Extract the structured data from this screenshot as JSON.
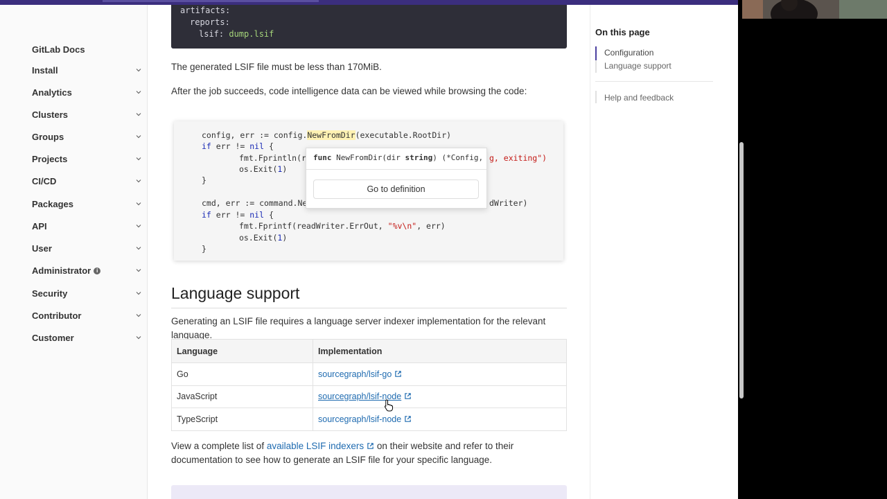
{
  "sidebar": {
    "brand": "GitLab Docs",
    "items": [
      {
        "label": "Install"
      },
      {
        "label": "Analytics"
      },
      {
        "label": "Clusters"
      },
      {
        "label": "Groups"
      },
      {
        "label": "Projects"
      },
      {
        "label": "CI/CD"
      },
      {
        "label": "Packages"
      },
      {
        "label": "API"
      },
      {
        "label": "User"
      },
      {
        "label": "Administrator"
      },
      {
        "label": "Security"
      },
      {
        "label": "Contributor"
      },
      {
        "label": "Customer"
      }
    ]
  },
  "code_top": {
    "line1_key": "artifacts:",
    "line2_key": "reports:",
    "line3_key": "lsif:",
    "line3_val": "dump.lsif"
  },
  "main": {
    "para_size": "The generated LSIF file must be less than 170MiB.",
    "para_job": "After the job succeeds, code intelligence data can be viewed while browsing the code:",
    "screenshot": {
      "l1_a": "config, err := config.",
      "l1_hl": "NewFromDir",
      "l1_b": "(executable.RootDir)",
      "l2_kw": "if",
      "l2_a": " err != ",
      "l2_nil": "nil",
      "l2_b": " {",
      "l3": "fmt.Fprintln(r",
      "l3_tail": "g, exiting\")",
      "l4_a": "os.Exit(",
      "l4_n": "1",
      "l4_b": ")",
      "l5": "}",
      "l6_a": "cmd, err := command.Ne",
      "l6_tail": "dWriter)",
      "l7_kw": "if",
      "l7_a": " err != ",
      "l7_nil": "nil",
      "l7_b": " {",
      "l8_a": "fmt.Fprintf(readWriter.ErrOut, ",
      "l8_s": "\"%v\\n\"",
      "l8_b": ", err)",
      "l9_a": "os.Exit(",
      "l9_n": "1",
      "l9_b": ")",
      "l10": "}",
      "popover": {
        "sig_kw": "func",
        "sig_a": " NewFromDir(dir ",
        "sig_type": "string",
        "sig_b": ") (*Config,",
        "button": "Go to definition"
      }
    },
    "heading": "Language support",
    "para_lang": "Generating an LSIF file requires a language server indexer implementation for the relevant language.",
    "table": {
      "headers": [
        "Language",
        "Implementation"
      ],
      "rows": [
        {
          "language": "Go",
          "impl": "sourcegraph/lsif-go"
        },
        {
          "language": "JavaScript",
          "impl": "sourcegraph/lsif-node"
        },
        {
          "language": "TypeScript",
          "impl": "sourcegraph/lsif-node"
        }
      ]
    },
    "para_view_a": "View a complete list of ",
    "para_view_link": "available LSIF indexers",
    "para_view_b": " on their website and refer to their documentation to see how to generate an LSIF file for your specific language."
  },
  "toc": {
    "title": "On this page",
    "items": [
      "Configuration",
      "Language support",
      "Help and feedback"
    ]
  },
  "colors": {
    "accent": "#3b2e7e",
    "link": "#1f6bb0",
    "toc_active": "#4b3fa0"
  }
}
